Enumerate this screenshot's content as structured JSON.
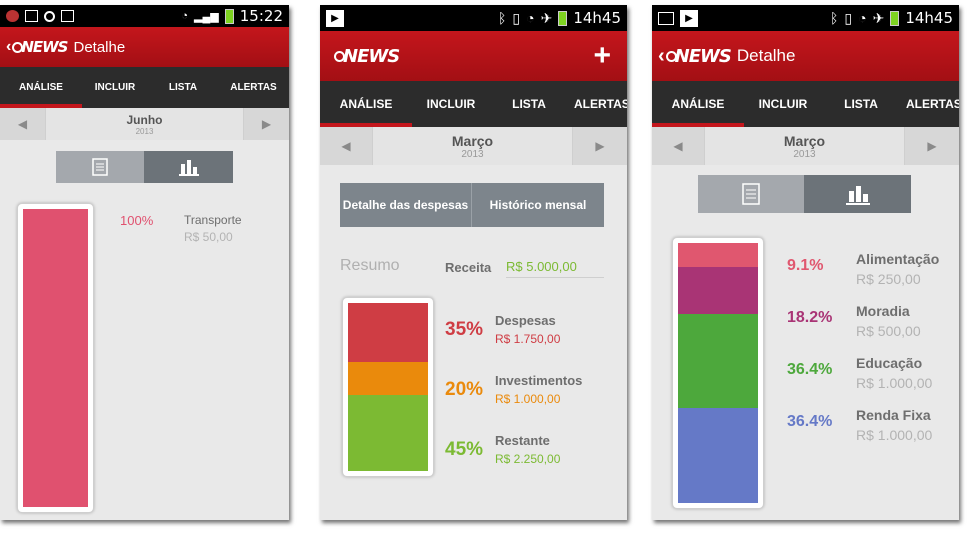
{
  "colors": {
    "brand_red": "#c4161c",
    "tab_bg": "#2c2c2c",
    "pink": "#e0516f",
    "red": "#cf3d44",
    "orange": "#ea8a0c",
    "green": "#7cba33",
    "rose": "#e0576f",
    "purple": "#a93475",
    "green2": "#4da83c",
    "blue": "#6579c7"
  },
  "screens": [
    {
      "status": {
        "time": "15:22"
      },
      "appbar": {
        "back": "‹",
        "logo": "NEWS",
        "title": "Detalhe"
      },
      "tabs": [
        "ANÁLISE",
        "INCLUIR",
        "LISTA",
        "ALERTAS"
      ],
      "month": {
        "name": "Junho",
        "year": "2013"
      },
      "items": [
        {
          "pct": "100%",
          "label": "Transporte",
          "amount": "R$ 50,00",
          "fraction": 1.0,
          "color": "#e0516f"
        }
      ]
    },
    {
      "status": {
        "time": "14h45"
      },
      "appbar": {
        "logo": "NEWS",
        "plus": "+"
      },
      "tabs": [
        "ANÁLISE",
        "INCLUIR",
        "LISTA",
        "ALERTAS"
      ],
      "month": {
        "name": "Março",
        "year": "2013"
      },
      "buttons": {
        "left": "Detalhe das despesas",
        "right": "Histórico mensal"
      },
      "resumo": {
        "label": "Resumo",
        "receita_label": "Receita",
        "receita_value": "R$ 5.000,00"
      },
      "items": [
        {
          "pct": "35%",
          "label": "Despesas",
          "amount": "R$ 1.750,00",
          "fraction": 0.35,
          "color": "#cf3d44"
        },
        {
          "pct": "20%",
          "label": "Investimentos",
          "amount": "R$ 1.000,00",
          "fraction": 0.2,
          "color": "#ea8a0c"
        },
        {
          "pct": "45%",
          "label": "Restante",
          "amount": "R$ 2.250,00",
          "fraction": 0.45,
          "color": "#7cba33"
        }
      ]
    },
    {
      "status": {
        "time": "14h45"
      },
      "appbar": {
        "back": "‹",
        "logo": "NEWS",
        "title": "Detalhe"
      },
      "tabs": [
        "ANÁLISE",
        "INCLUIR",
        "LISTA",
        "ALERTAS"
      ],
      "month": {
        "name": "Março",
        "year": "2013"
      },
      "items": [
        {
          "pct": "9.1%",
          "label": "Alimentação",
          "amount": "R$ 250,00",
          "fraction": 0.091,
          "color": "#e0576f"
        },
        {
          "pct": "18.2%",
          "label": "Moradia",
          "amount": "R$ 500,00",
          "fraction": 0.182,
          "color": "#a93475"
        },
        {
          "pct": "36.4%",
          "label": "Educação",
          "amount": "R$ 1.000,00",
          "fraction": 0.364,
          "color": "#4da83c"
        },
        {
          "pct": "36.4%",
          "label": "Renda Fixa",
          "amount": "R$ 1.000,00",
          "fraction": 0.364,
          "color": "#6579c7"
        }
      ]
    }
  ]
}
